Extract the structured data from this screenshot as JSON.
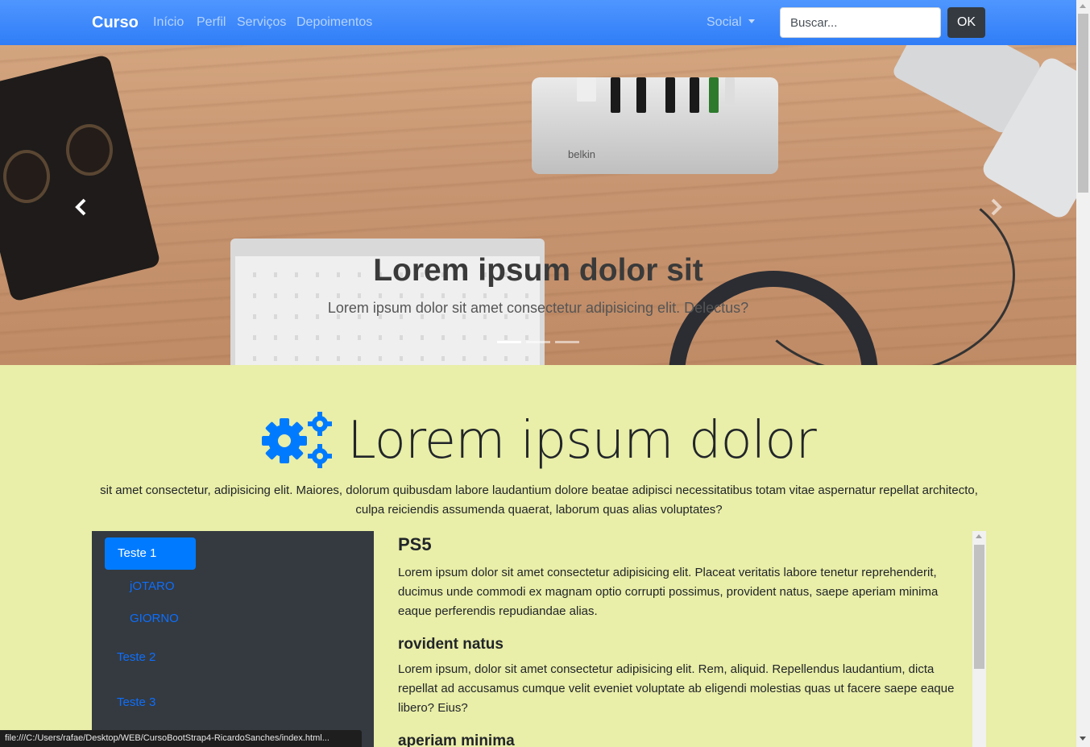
{
  "navbar": {
    "brand": "Curso",
    "links": [
      "Início",
      "Perfil",
      "Serviços",
      "Depoimentos"
    ],
    "social": "Social",
    "search_placeholder": "Buscar...",
    "ok_label": "OK"
  },
  "carousel": {
    "title": "Lorem ipsum dolor sit",
    "text": "Lorem ipsum dolor sit amet consectetur adipisicing elit. Delectus?",
    "hub_brand": "belkin",
    "indicators": 3,
    "active_indicator": 0
  },
  "section": {
    "headline": "Lorem ipsum dolor",
    "lead": "sit amet consectetur, adipisicing elit. Maiores, dolorum quibusdam labore laudantium dolore beatae adipisci necessitatibus totam vitae aspernatur repellat architecto, culpa reiciendis assumenda quaerat, laborum quas alias voluptates?"
  },
  "sidebar": {
    "active": "Teste 1",
    "sub_items": [
      "jOTARO",
      "GIORNO"
    ],
    "items": [
      "Teste 2",
      "Teste 3"
    ]
  },
  "content": {
    "h1": "PS5",
    "p1": "Lorem ipsum dolor sit amet consectetur adipisicing elit. Placeat veritatis labore tenetur reprehenderit, ducimus unde commodi ex magnam optio corrupti possimus, provident natus, saepe aperiam minima eaque perferendis repudiandae alias.",
    "h2": "rovident natus",
    "p2": "Lorem ipsum, dolor sit amet consectetur adipisicing elit. Rem, aliquid. Repellendus laudantium, dicta repellat ad accusamus cumque velit eveniet voluptate ab eligendi molestias quas ut facere saepe eaque libero? Eius?",
    "h3": "aperiam minima"
  },
  "statusbar": "file:///C:/Users/rafae/Desktop/WEB/CursoBootStrap4-RicardoSanches/index.html...",
  "colors": {
    "navbar": "#3d87fb",
    "section_bg": "#e9eea8",
    "sidebar_bg": "#343a40",
    "primary": "#007bff"
  }
}
